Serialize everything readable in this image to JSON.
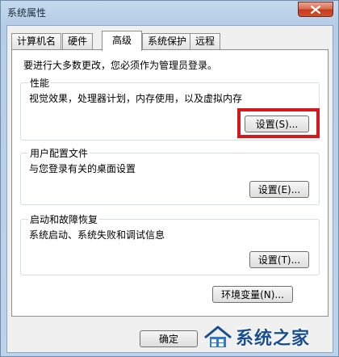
{
  "window": {
    "title": "系统属性",
    "close_icon": "close-icon"
  },
  "tabs": [
    {
      "label": "计算机名"
    },
    {
      "label": "硬件"
    },
    {
      "label": "高级",
      "active": true
    },
    {
      "label": "系统保护"
    },
    {
      "label": "远程"
    }
  ],
  "advanced": {
    "intro": "要进行大多数更改，您必须作为管理员登录。",
    "performance": {
      "title": "性能",
      "desc": "视觉效果，处理器计划，内存使用，以及虚拟内存",
      "button": "设置(S)..."
    },
    "user_profiles": {
      "title": "用户配置文件",
      "desc": "与您登录有关的桌面设置",
      "button": "设置(E)..."
    },
    "startup_recovery": {
      "title": "启动和故障恢复",
      "desc": "系统启动、系统失败和调试信息",
      "button": "设置(T)..."
    },
    "env_button": "环境变量(N)..."
  },
  "footer": {
    "ok": "确定"
  },
  "watermark": {
    "text": "系统之家"
  },
  "colors": {
    "highlight": "#d4181e",
    "close_button": "#c2381b"
  }
}
